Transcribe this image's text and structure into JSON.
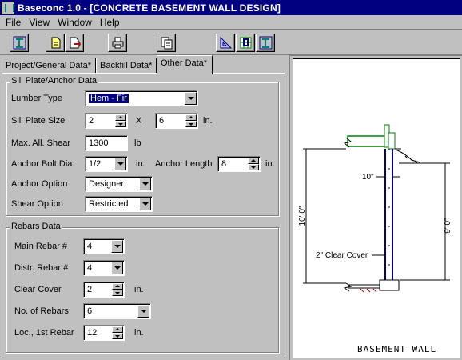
{
  "window": {
    "title": "Baseconc 1.0 - [CONCRETE BASEMENT WALL DESIGN]"
  },
  "menu": [
    "File",
    "View",
    "Window",
    "Help"
  ],
  "toolbar": {
    "buttons": [
      "wall-icon",
      "new-doc-icon",
      "open-doc-icon",
      "print-icon",
      "copy-pages-icon",
      "triangle-ruler-icon",
      "grid-select-icon",
      "wall-design-icon"
    ]
  },
  "tabs": [
    "Project/General Data*",
    "Backfill Data*",
    "Other Data*"
  ],
  "sill": {
    "title": "Sill Plate/Anchor Data",
    "lumber_type_label": "Lumber Type",
    "lumber_type_value": "Hem - Fir",
    "sill_plate_size_label": "Sill Plate Size",
    "sill_width": "2",
    "times": "X",
    "sill_depth": "6",
    "unit_in": "in.",
    "max_shear_label": "Max. All. Shear",
    "max_shear_value": "1300",
    "unit_lb": "lb",
    "anchor_bolt_label": "Anchor Bolt Dia.",
    "anchor_bolt_value": "1/2",
    "anchor_length_label": "Anchor Length",
    "anchor_length_value": "8",
    "anchor_option_label": "Anchor Option",
    "anchor_option_value": "Designer",
    "shear_option_label": "Shear Option",
    "shear_option_value": "Restricted"
  },
  "rebars": {
    "title": "Rebars Data",
    "main_rebar_label": "Main Rebar #",
    "main_rebar_value": "4",
    "distr_rebar_label": "Distr. Rebar #",
    "distr_rebar_value": "4",
    "clear_cover_label": "Clear Cover",
    "clear_cover_value": "2",
    "no_rebars_label": "No. of Rebars",
    "no_rebars_value": "6",
    "loc_rebar_label": "Loc., 1st Rebar",
    "loc_rebar_value": "12",
    "unit_in": "in."
  },
  "drawing": {
    "title": "BASEMENT WALL",
    "dim_total": "10' 0\"",
    "dim_wall": "9' 0\"",
    "dim_thickness": "10\"",
    "dim_cover": "2\" Clear Cover"
  },
  "colors": {
    "titlebar": "#000080",
    "face": "#c0c0c0",
    "wall_line": "#000080",
    "slab_green": "#008000"
  }
}
